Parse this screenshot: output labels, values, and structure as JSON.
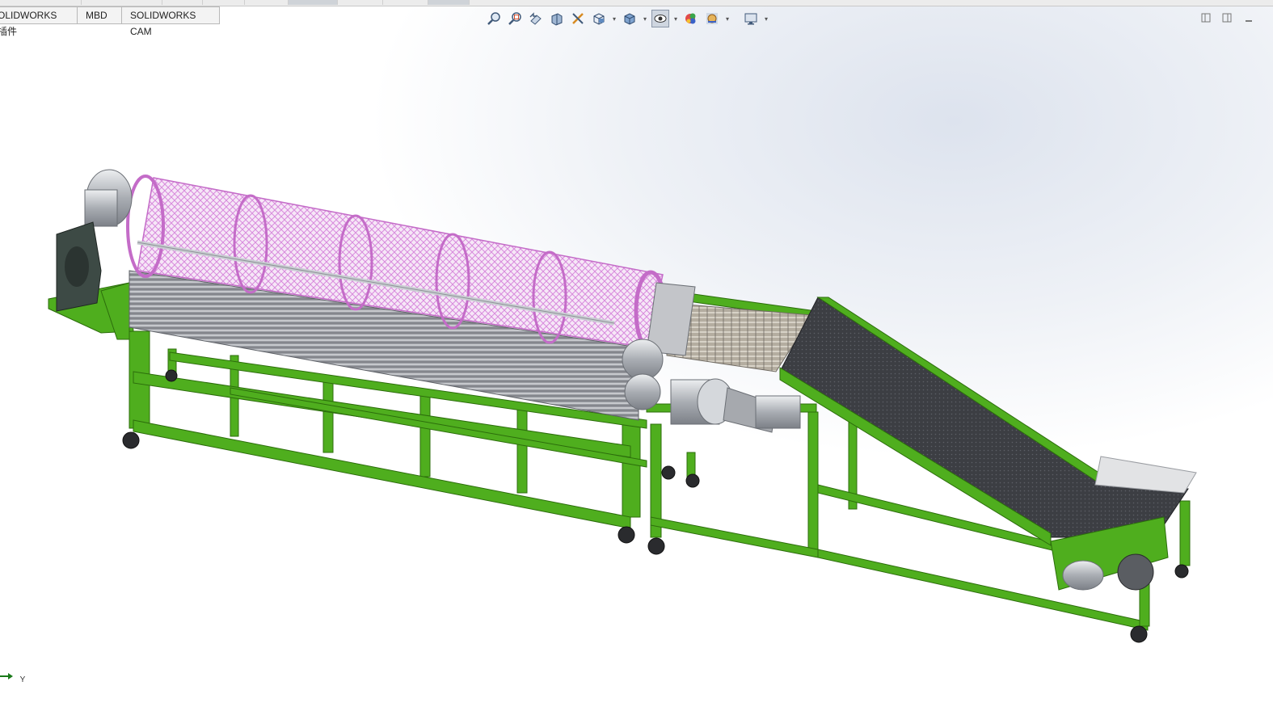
{
  "command_manager": {
    "tabs": [
      {
        "label": "OLIDWORKS 插件"
      },
      {
        "label": "MBD"
      },
      {
        "label": "SOLIDWORKS CAM"
      }
    ]
  },
  "heads_up_toolbar": {
    "buttons": [
      {
        "name": "zoom-to-fit-icon"
      },
      {
        "name": "zoom-to-area-icon"
      },
      {
        "name": "previous-view-icon"
      },
      {
        "name": "section-view-icon"
      },
      {
        "name": "dynamic-annotation-icon"
      },
      {
        "name": "view-orientation-icon",
        "dropdown": true
      },
      {
        "name": "display-style-icon",
        "dropdown": true
      },
      {
        "name": "hide-show-items-icon",
        "dropdown": true,
        "active": true
      },
      {
        "name": "edit-appearance-icon"
      },
      {
        "name": "apply-scene-icon",
        "dropdown": true
      },
      {
        "name": "view-settings-icon",
        "dropdown": true
      }
    ]
  },
  "window_controls": [
    "tile-left-icon",
    "tile-right-icon",
    "minimize-icon"
  ],
  "model": {
    "description_name": "drum-washer-conveyor-assembly",
    "colors": {
      "frame": "#4fae1e",
      "frame_dark": "#2f7a0c",
      "drum": "#e39be6",
      "belt": "#3b3d42",
      "motor": "#bfc2c6",
      "gearbox": "#3d4a45"
    }
  },
  "triad": {
    "axis_label": "Y"
  }
}
